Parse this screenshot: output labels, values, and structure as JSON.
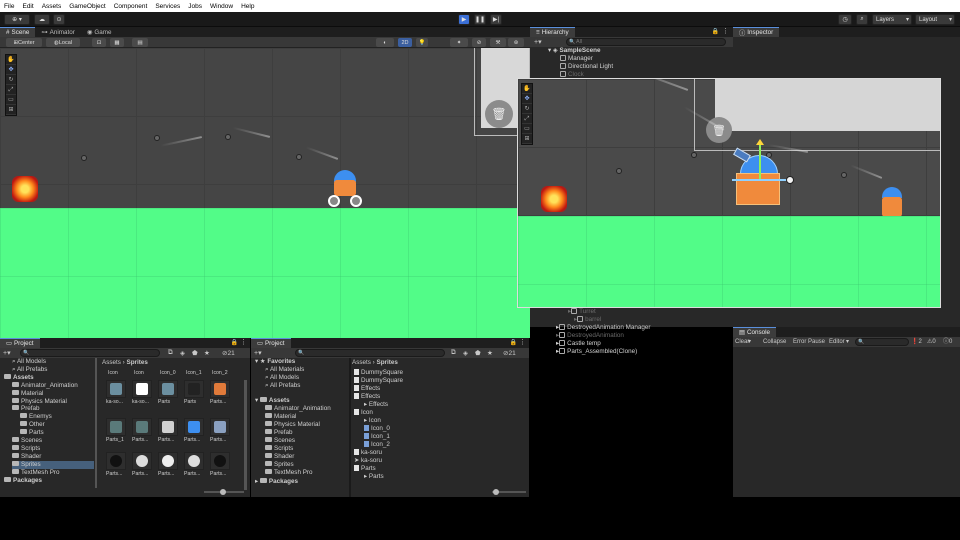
{
  "menu": [
    "File",
    "Edit",
    "Assets",
    "GameObject",
    "Component",
    "Services",
    "Jobs",
    "Window",
    "Help"
  ],
  "toolbar": {
    "layers_label": "Layers",
    "layout_label": "Layout"
  },
  "scene_tabs": {
    "scene": "Scene",
    "animator": "Animator",
    "game": "Game"
  },
  "scene_bar": {
    "pivot": "Center",
    "space": "Local",
    "mode_2d": "2D"
  },
  "hierarchy": {
    "tab": "Hierarchy",
    "search_placeholder": "All",
    "scene_name": "SampleScene",
    "top_items": [
      "Manager",
      "Directional Light"
    ],
    "partial_item": "Clock",
    "bottom_items": [
      {
        "label": "Turret",
        "dim": true,
        "indent": 2
      },
      {
        "label": "barrel",
        "dim": true,
        "indent": 3
      },
      {
        "label": "DestroyedAnimation Manager",
        "dim": false,
        "indent": 0
      },
      {
        "label": "DestroyedAnimation",
        "dim": true,
        "indent": 0
      },
      {
        "label": "Castle temp",
        "dim": false,
        "indent": 0
      },
      {
        "label": "Parts_Assembled(Clone)",
        "dim": false,
        "indent": 0
      }
    ]
  },
  "inspector": {
    "tab": "Inspector"
  },
  "console": {
    "tab": "Console",
    "clear": "Clear",
    "collapse": "Collapse",
    "error_pause": "Error Pause",
    "editor": "Editor",
    "warnings": "2",
    "errors": "0",
    "messages": "0"
  },
  "project1": {
    "tab": "Project",
    "tree": [
      {
        "label": "All Models",
        "indent": 1,
        "kind": "search"
      },
      {
        "label": "All Prefabs",
        "indent": 1,
        "kind": "search"
      },
      {
        "label": "Assets",
        "indent": 0,
        "kind": "bold"
      },
      {
        "label": "Animator_Animation",
        "indent": 1,
        "kind": "folder"
      },
      {
        "label": "Material",
        "indent": 1,
        "kind": "folder"
      },
      {
        "label": "Physics Material",
        "indent": 1,
        "kind": "folder"
      },
      {
        "label": "Prefab",
        "indent": 1,
        "kind": "folder"
      },
      {
        "label": "Enemys",
        "indent": 2,
        "kind": "folder"
      },
      {
        "label": "Other",
        "indent": 2,
        "kind": "folder"
      },
      {
        "label": "Parts",
        "indent": 2,
        "kind": "folder"
      },
      {
        "label": "Scenes",
        "indent": 1,
        "kind": "folder"
      },
      {
        "label": "Scripts",
        "indent": 1,
        "kind": "folder"
      },
      {
        "label": "Shader",
        "indent": 1,
        "kind": "folder"
      },
      {
        "label": "Sprites",
        "indent": 1,
        "kind": "folder",
        "selected": true
      },
      {
        "label": "TextMesh Pro",
        "indent": 1,
        "kind": "folder"
      },
      {
        "label": "Packages",
        "indent": 0,
        "kind": "bold"
      }
    ],
    "breadcrumb": [
      "Assets",
      "Sprites"
    ],
    "row1_labels": [
      "Icon",
      "Icon",
      "Icon_0",
      "Icon_1",
      "Icon_2"
    ],
    "row2_labels": [
      "ka-so...",
      "ka-so...",
      "Parts",
      "Parts",
      "Parts..."
    ],
    "row3_labels": [
      "Parts_1",
      "Parts...",
      "Parts...",
      "Parts...",
      "Parts..."
    ],
    "row4_labels": [
      "Parts...",
      "Parts...",
      "Parts...",
      "Parts...",
      "Parts..."
    ],
    "count": "21"
  },
  "project2": {
    "tab": "Project",
    "favorites": "Favorites",
    "fav_items": [
      "All Materials",
      "All Models",
      "All Prefabs"
    ],
    "assets": "Assets",
    "asset_items": [
      "Animator_Animation",
      "Material",
      "Physics Material",
      "Prefab",
      "Scenes",
      "Scripts",
      "Shader",
      "Sprites",
      "TextMesh Pro"
    ],
    "packages": "Packages",
    "breadcrumb": [
      "Assets",
      "Sprites"
    ],
    "list": [
      {
        "label": "DummySquare",
        "indent": 0,
        "kind": "file"
      },
      {
        "label": "DummySquare",
        "indent": 0,
        "kind": "file"
      },
      {
        "label": "Effects",
        "indent": 0,
        "kind": "file"
      },
      {
        "label": "Effects",
        "indent": 0,
        "kind": "file"
      },
      {
        "label": "Effects",
        "indent": 1,
        "kind": "none"
      },
      {
        "label": "Icon",
        "indent": 0,
        "kind": "file"
      },
      {
        "label": "Icon",
        "indent": 1,
        "kind": "none"
      },
      {
        "label": "Icon_0",
        "indent": 1,
        "kind": "sub"
      },
      {
        "label": "Icon_1",
        "indent": 1,
        "kind": "sub"
      },
      {
        "label": "Icon_2",
        "indent": 1,
        "kind": "sub"
      },
      {
        "label": "ka-soru",
        "indent": 0,
        "kind": "file"
      },
      {
        "label": "ka-soru",
        "indent": 0,
        "kind": "arrow"
      },
      {
        "label": "Parts",
        "indent": 0,
        "kind": "file"
      },
      {
        "label": "Parts",
        "indent": 1,
        "kind": "none"
      }
    ],
    "count": "21"
  },
  "colors": {
    "ground": "#52fc88",
    "scene_bg": "#454545",
    "panel": "#282828",
    "accent": "#3b6fd6"
  }
}
